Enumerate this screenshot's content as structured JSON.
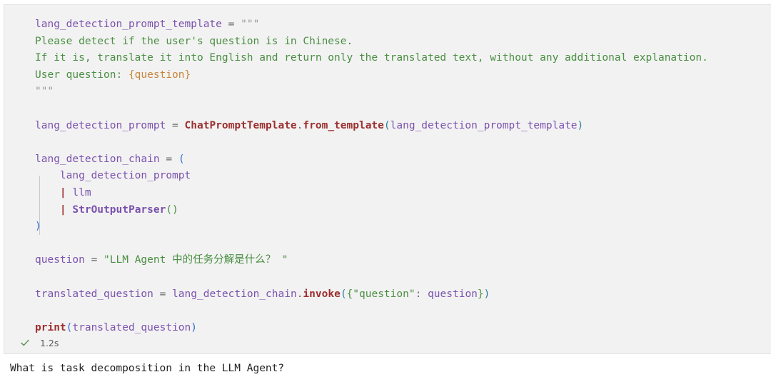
{
  "cell": {
    "language": "python",
    "background_color": "#f2f2f2",
    "border_color": "#e3e3e0",
    "code_lines": [
      {
        "id": "l1",
        "tokens": [
          {
            "t": "lang_detection_prompt_template",
            "c": "t-var"
          },
          {
            "t": " = ",
            "c": "t-op"
          },
          {
            "t": "\"\"\"",
            "c": "t-strq"
          }
        ]
      },
      {
        "id": "l2",
        "tokens": [
          {
            "t": "Please detect if the user's question is in Chinese.",
            "c": "t-str"
          }
        ]
      },
      {
        "id": "l3",
        "tokens": [
          {
            "t": "If it is, translate it into English and return only the translated text, without any additional explanation.",
            "c": "t-str"
          }
        ]
      },
      {
        "id": "l4",
        "tokens": [
          {
            "t": "User question: ",
            "c": "t-str"
          },
          {
            "t": "{question}",
            "c": "t-brace"
          }
        ]
      },
      {
        "id": "l5",
        "tokens": [
          {
            "t": "\"\"\"",
            "c": "t-strq"
          }
        ]
      },
      {
        "id": "l6",
        "tokens": []
      },
      {
        "id": "l7",
        "tokens": [
          {
            "t": "lang_detection_prompt",
            "c": "t-var"
          },
          {
            "t": " = ",
            "c": "t-op"
          },
          {
            "t": "ChatPromptTemplate",
            "c": "t-cls"
          },
          {
            "t": ".",
            "c": "t-op"
          },
          {
            "t": "from_template",
            "c": "t-fn"
          },
          {
            "t": "(",
            "c": "t-paren"
          },
          {
            "t": "lang_detection_prompt_template",
            "c": "t-var"
          },
          {
            "t": ")",
            "c": "t-paren"
          }
        ]
      },
      {
        "id": "l8",
        "tokens": []
      },
      {
        "id": "l9",
        "tokens": [
          {
            "t": "lang_detection_chain",
            "c": "t-var"
          },
          {
            "t": " = ",
            "c": "t-op"
          },
          {
            "t": "(",
            "c": "t-paren-b"
          }
        ]
      },
      {
        "id": "l10",
        "tokens": [
          {
            "t": "    lang_detection_prompt",
            "c": "t-var"
          }
        ]
      },
      {
        "id": "l11",
        "tokens": [
          {
            "t": "    | ",
            "c": "t-pipe"
          },
          {
            "t": "llm",
            "c": "t-var"
          }
        ]
      },
      {
        "id": "l12",
        "tokens": [
          {
            "t": "    | ",
            "c": "t-pipe"
          },
          {
            "t": "StrOutputParser",
            "c": "t-bold-var"
          },
          {
            "t": "()",
            "c": "t-paren-g"
          }
        ]
      },
      {
        "id": "l13",
        "tokens": [
          {
            "t": ")",
            "c": "t-paren-b"
          }
        ]
      },
      {
        "id": "l14",
        "tokens": []
      },
      {
        "id": "l15",
        "tokens": [
          {
            "t": "question",
            "c": "t-var"
          },
          {
            "t": " = ",
            "c": "t-op"
          },
          {
            "t": "\"LLM Agent ",
            "c": "t-str"
          },
          {
            "t": "中的任务分解是什么？",
            "c": "t-cjk"
          },
          {
            "t": " \"",
            "c": "t-str"
          }
        ]
      },
      {
        "id": "l16",
        "tokens": []
      },
      {
        "id": "l17",
        "tokens": [
          {
            "t": "translated_question",
            "c": "t-var"
          },
          {
            "t": " = ",
            "c": "t-op"
          },
          {
            "t": "lang_detection_chain",
            "c": "t-var"
          },
          {
            "t": ".",
            "c": "t-op"
          },
          {
            "t": "invoke",
            "c": "t-fn"
          },
          {
            "t": "(",
            "c": "t-paren"
          },
          {
            "t": "{",
            "c": "t-paren-g"
          },
          {
            "t": "\"question\"",
            "c": "t-str"
          },
          {
            "t": ": ",
            "c": "t-op"
          },
          {
            "t": "question",
            "c": "t-var"
          },
          {
            "t": "}",
            "c": "t-paren-g"
          },
          {
            "t": ")",
            "c": "t-paren"
          }
        ]
      },
      {
        "id": "l18",
        "tokens": []
      },
      {
        "id": "l19",
        "tokens": [
          {
            "t": "print",
            "c": "t-builtin"
          },
          {
            "t": "(",
            "c": "t-paren-b"
          },
          {
            "t": "translated_question",
            "c": "t-var"
          },
          {
            "t": ")",
            "c": "t-paren-b"
          }
        ]
      }
    ],
    "status": {
      "icon": "check-icon",
      "icon_color": "#4a8f42",
      "execution_time": "1.2s"
    }
  },
  "output": {
    "lines": [
      "What is task decomposition in the LLM Agent?"
    ]
  }
}
